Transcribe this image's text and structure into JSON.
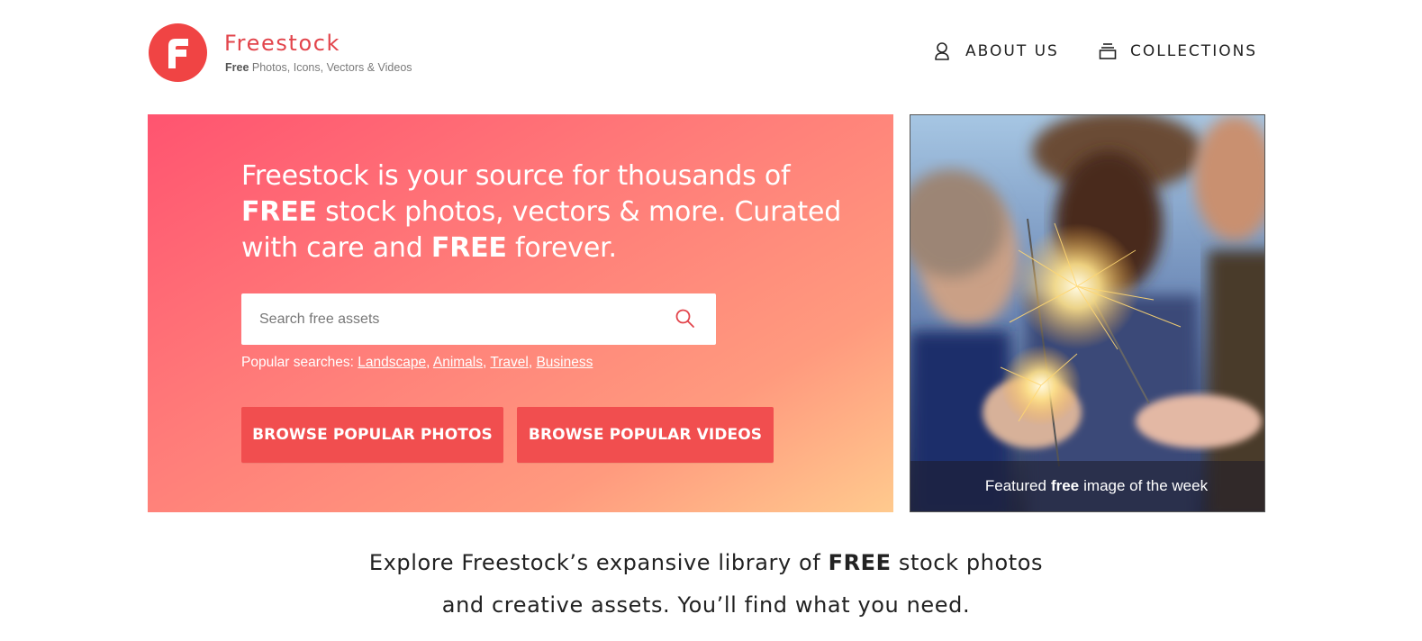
{
  "brand": {
    "name": "Freestock",
    "tag_bold": "Free",
    "tag_rest": "Photos, Icons, Vectors & Videos",
    "color": "#e2444b"
  },
  "nav": {
    "about_label": "ABOUT US",
    "about_icon": "user-icon",
    "collections_label": "COLLECTIONS",
    "collections_icon": "collections-icon"
  },
  "hero": {
    "line1": "Freestock is your source for thousands of",
    "line2_bold": "FREE",
    "line2_rest": " stock photos, vectors & more. Curated",
    "line3_start": "with care and ",
    "line3_bold": "FREE",
    "line3_end": " forever.",
    "gradient_start": "#ff5470",
    "gradient_end": "#ffca8e"
  },
  "search": {
    "placeholder": "Search free assets",
    "value": "",
    "icon": "search-icon"
  },
  "popular_searches": {
    "label": "Popular searches: ",
    "items": [
      "Landscape",
      "Animals",
      "Travel",
      "Business"
    ],
    "separator": ", "
  },
  "buttons": {
    "photos_label": "BROWSE POPULAR PHOTOS",
    "videos_label": "BROWSE POPULAR VIDEOS",
    "color": "#f14e4f"
  },
  "featured": {
    "caption_start": "Featured",
    "caption_bold": "free",
    "caption_end": "image of the week"
  },
  "explore": {
    "line1_start": "Explore Freestock’s expansive library of ",
    "line1_bold": "FREE",
    "line1_end": " stock photos",
    "line2": "and creative assets. You’ll find what you need."
  }
}
